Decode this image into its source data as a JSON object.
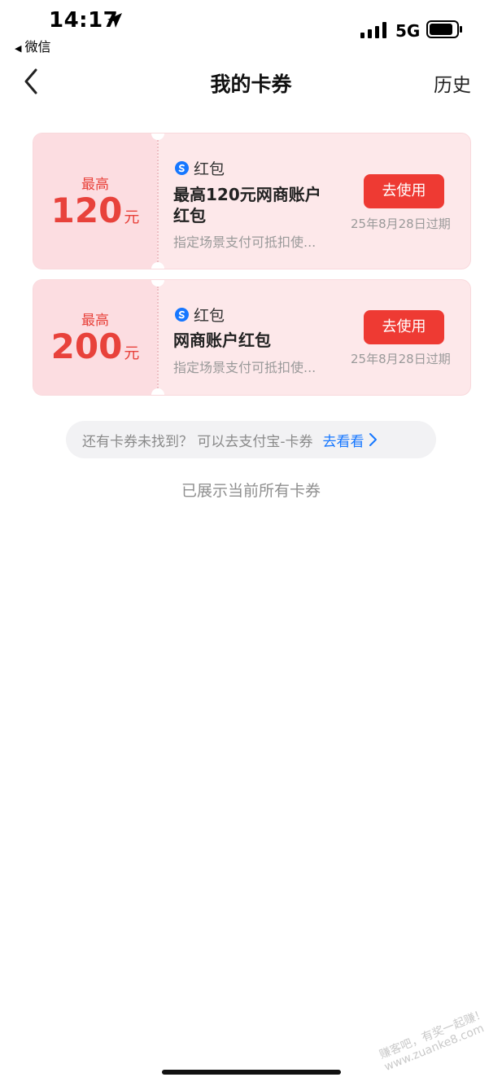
{
  "status_bar": {
    "time": "14:17",
    "back_app": "微信",
    "network": "5G"
  },
  "nav": {
    "title": "我的卡券",
    "history": "历史"
  },
  "coupons": [
    {
      "amount_label": "最高",
      "amount": "120",
      "unit": "元",
      "tag": "红包",
      "title_line1": "最高120元网商账户",
      "title_line2": "红包",
      "desc": "指定场景支付可抵扣使...",
      "button": "去使用",
      "expire": "25年8月28日过期"
    },
    {
      "amount_label": "最高",
      "amount": "200",
      "unit": "元",
      "tag": "红包",
      "title_line1": "网商账户红包",
      "title_line2": "",
      "desc": "指定场景支付可抵扣使...",
      "button": "去使用",
      "expire": "25年8月28日过期"
    }
  ],
  "hint": {
    "text": "还有卡券未找到？ 可以去支付宝-卡券",
    "link": "去看看"
  },
  "footer_text": "已展示当前所有卡券",
  "watermark": {
    "line1": "赚客吧，有奖一起赚！",
    "line2": "www.zuanke8.com"
  },
  "colors": {
    "accent_red": "#ee3a33",
    "amount_red": "#e8423b",
    "card_bg": "#fde8ea",
    "link_blue": "#1677ff"
  },
  "icons": {
    "location": "location-arrow-icon",
    "signal": "cellular-signal-icon",
    "battery": "battery-icon",
    "back": "chevron-left-icon",
    "tag": "alipay-logo-icon",
    "hint_arrow": "chevron-right-icon"
  }
}
